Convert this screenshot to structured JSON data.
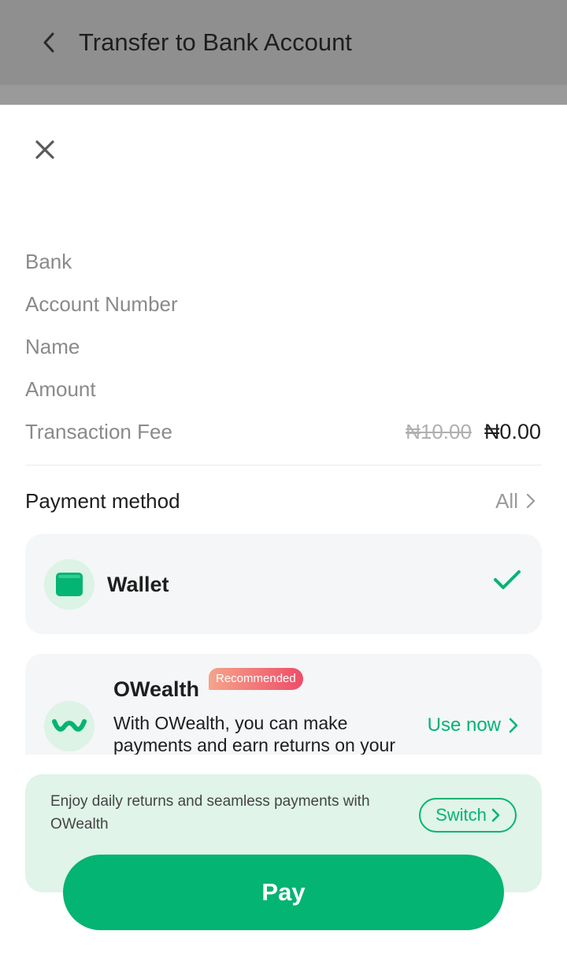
{
  "header": {
    "title": "Transfer to Bank Account",
    "back_icon": "chevron-left-icon"
  },
  "sheet": {
    "close_icon": "close-icon",
    "fields": {
      "bank_label": "Bank",
      "account_number_label": "Account Number",
      "name_label": "Name",
      "amount_label": "Amount",
      "fee_label": "Transaction Fee",
      "fee_original": "₦10.00",
      "fee_current": "₦0.00"
    },
    "payment_method": {
      "label": "Payment method",
      "all_label": "All"
    },
    "wallet": {
      "name": "Wallet",
      "icon": "wallet-icon",
      "selected": true
    },
    "owealth": {
      "name": "OWealth",
      "badge": "Recommended",
      "description": "With OWealth, you can make payments and earn returns on your",
      "action": "Use now",
      "icon": "owealth-logo-icon"
    },
    "promo": {
      "text": "Enjoy daily returns and seamless payments with OWealth",
      "button": "Switch"
    },
    "pay_button": "Pay"
  },
  "colors": {
    "accent": "#03b472",
    "overlay": "#8f8f8f",
    "badge_start": "#f5a48a",
    "badge_end": "#ee4d68"
  }
}
